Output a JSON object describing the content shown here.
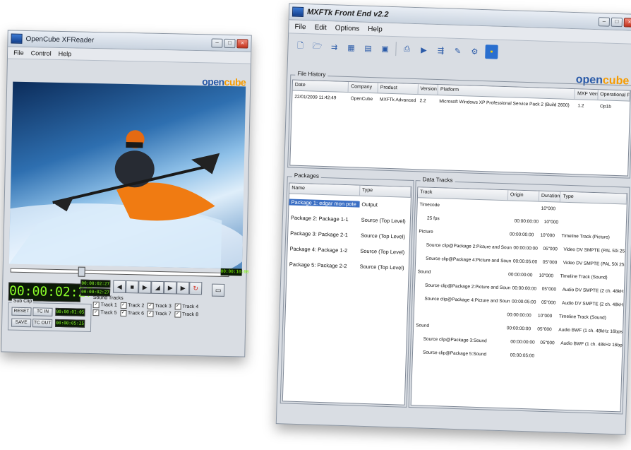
{
  "xfreader": {
    "title": "OpenCube XFReader",
    "menu": [
      "File",
      "Control",
      "Help"
    ],
    "logo": {
      "main": "open",
      "accent": "cube"
    },
    "progress": 0.32,
    "timecode_main": "00:00:02:27",
    "timecode_a": "00:00:02:27",
    "timecode_b": "00:00:02:27",
    "timecode_end": "00:00:10:00",
    "subclip": {
      "title": "Sub Clip",
      "reset": "RESET",
      "tc_in": "TC IN",
      "save": "SAVE",
      "tc_out": "TC OUT",
      "in_value": "00:00:01:05",
      "out_value": "00:00:05:25"
    },
    "sound_tracks": {
      "title": "Sound Tracks",
      "tracks": [
        "Track 1",
        "Track 2",
        "Track 3",
        "Track 4",
        "Track 5",
        "Track 6",
        "Track 7",
        "Track 8"
      ]
    }
  },
  "mxftk": {
    "title": "MXFTk Front End v2.2",
    "menu": [
      "File",
      "Edit",
      "Options",
      "Help"
    ],
    "logo": {
      "main": "open",
      "accent": "cube"
    },
    "file_history": {
      "title": "File History",
      "columns": [
        "Date",
        "Company",
        "Product",
        "Version",
        "Platform",
        "MXF Version",
        "Operational Pattern"
      ],
      "rows": [
        [
          "22/01/2009 11:42:49",
          "OpenCube",
          "MXFTk Advanced",
          "2.2",
          "Microsoft Windows XP Professional Service Pack 2 (Build 2600)",
          "1.2",
          "Op1b"
        ]
      ]
    },
    "packages": {
      "title": "Packages",
      "columns": [
        "Name",
        "Type"
      ],
      "rows": [
        [
          "Package 1: edgar mon pote",
          "Output"
        ],
        [
          "Package 2: Package 1-1",
          "Source (Top Level)"
        ],
        [
          "Package 3: Package 2-1",
          "Source (Top Level)"
        ],
        [
          "Package 4: Package 1-2",
          "Source (Top Level)"
        ],
        [
          "Package 5: Package 2-2",
          "Source (Top Level)"
        ]
      ]
    },
    "data_tracks": {
      "title": "Data Tracks",
      "columns": [
        "Track",
        "Origin",
        "Duration",
        "Type"
      ],
      "rows": [
        [
          "Timecode",
          "",
          "10\"000",
          ""
        ],
        [
          "25 fps",
          "00:00:00:00",
          "10\"000",
          ""
        ],
        [
          "Picture",
          "00:00:00:00",
          "10\"000",
          "Timeline Track (Picture)"
        ],
        [
          "Source clip@Package 2:Picture and Sound",
          "00:00:00:00",
          "05\"000",
          "Video DV SMPTE (PAL 50i 25Mbps 16/9)"
        ],
        [
          "Source clip@Package 4:Picture and Sound",
          "00:00:05:00",
          "05\"000",
          "Video DV SMPTE (PAL 50i 25Mbps 16/9)"
        ],
        [
          "Sound",
          "00:00:00:00",
          "10\"000",
          "Timeline Track (Sound)"
        ],
        [
          "Source clip@Package 2:Picture and Sound",
          "00:00:00:00",
          "05\"000",
          "Audio DV SMPTE (2 ch. 48kHz 16bps)"
        ],
        [
          "Source clip@Package 4:Picture and Sound",
          "00:00:05:00",
          "05\"000",
          "Audio DV SMPTE (2 ch. 48kHz 16bps)"
        ],
        [
          "",
          "00:00:00:00",
          "10\"000",
          "Timeline Track (Sound)"
        ],
        [
          "Sound",
          "00:00:00:00",
          "05\"000",
          "Audio BWF (1 ch. 48kHz 16bps)"
        ],
        [
          "Source clip@Package 3:Sound",
          "00:00:00:00",
          "05\"000",
          "Audio BWF (1 ch. 48kHz 16bps)"
        ],
        [
          "Source clip@Package 5:Sound",
          "00:00:05:00",
          "",
          ""
        ]
      ]
    }
  }
}
